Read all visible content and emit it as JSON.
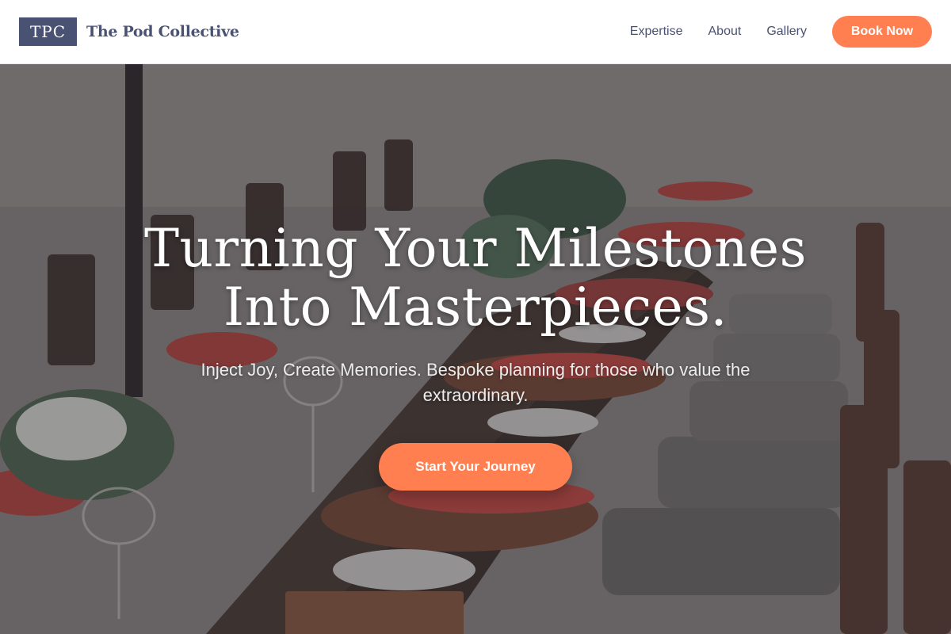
{
  "header": {
    "logo_mark": "TPC",
    "brand_name": "The Pod Collective",
    "nav": [
      {
        "label": "Expertise"
      },
      {
        "label": "About"
      },
      {
        "label": "Gallery"
      }
    ],
    "book_label": "Book Now"
  },
  "hero": {
    "title_line1": "Turning Your Milestones",
    "title_line2": "Into Masterpieces.",
    "subtitle": "Inject Joy, Create Memories. Bespoke planning for those who value the extraordinary.",
    "cta_label": "Start Your Journey",
    "background_image": "outdoor-dining-table-scene"
  },
  "colors": {
    "brand": "#4a5273",
    "accent": "#ff7f50",
    "header_bg": "#ffffff",
    "hero_text": "#ffffff"
  }
}
